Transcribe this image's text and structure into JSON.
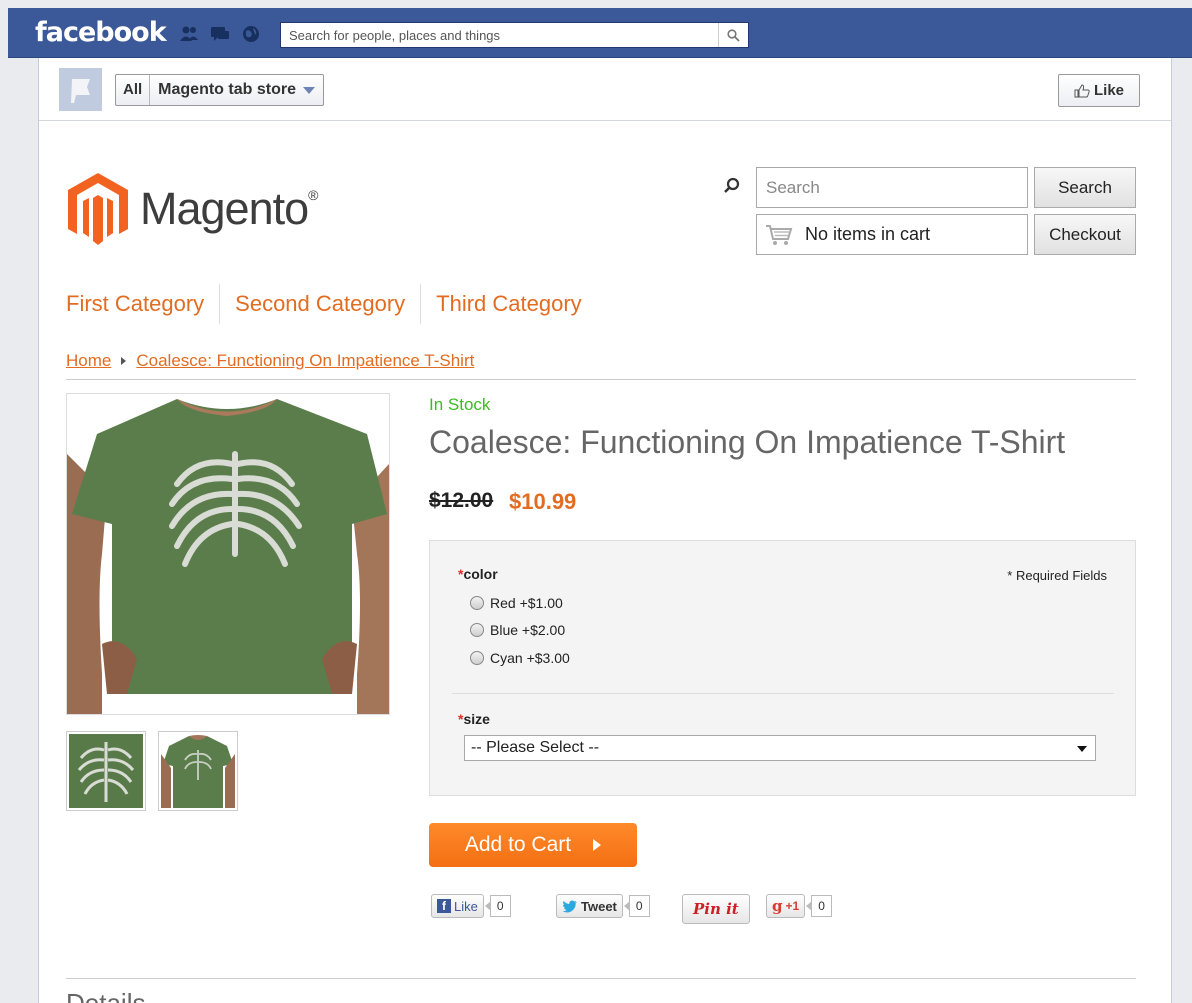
{
  "facebook": {
    "logo": "facebook",
    "search_placeholder": "Search for people, places and things",
    "icons": [
      "friends-icon",
      "messages-icon",
      "globe-icon",
      "search-icon"
    ],
    "brand_color": "#3b5998"
  },
  "page_header": {
    "all_label": "All",
    "store_label": "Magento tab store",
    "like_label": "Like"
  },
  "store": {
    "logo_text": "Magento",
    "logo_mark": "®",
    "search_placeholder": "Search",
    "search_button": "Search",
    "cart_text": "No items in cart",
    "checkout_button": "Checkout",
    "accent_color": "#e26c21"
  },
  "categories": [
    "First Category",
    "Second Category",
    "Third Category"
  ],
  "breadcrumb": {
    "home": "Home",
    "current": "Coalesce: Functioning On Impatience T-Shirt"
  },
  "product": {
    "stock": "In Stock",
    "title": "Coalesce: Functioning On Impatience T-Shirt",
    "old_price": "$12.00",
    "new_price": "$10.99",
    "color_label": "color",
    "required_note": "* Required Fields",
    "color_options": [
      "Red +$1.00",
      "Blue +$2.00",
      "Cyan +$3.00"
    ],
    "size_label": "size",
    "size_selected": "-- Please Select --",
    "add_to_cart": "Add to Cart"
  },
  "social": {
    "fb_like": "Like",
    "fb_count": "0",
    "tweet": "Tweet",
    "tweet_count": "0",
    "pin": "Pin it",
    "gplus": "+1",
    "gplus_count": "0"
  },
  "details_heading": "Details"
}
